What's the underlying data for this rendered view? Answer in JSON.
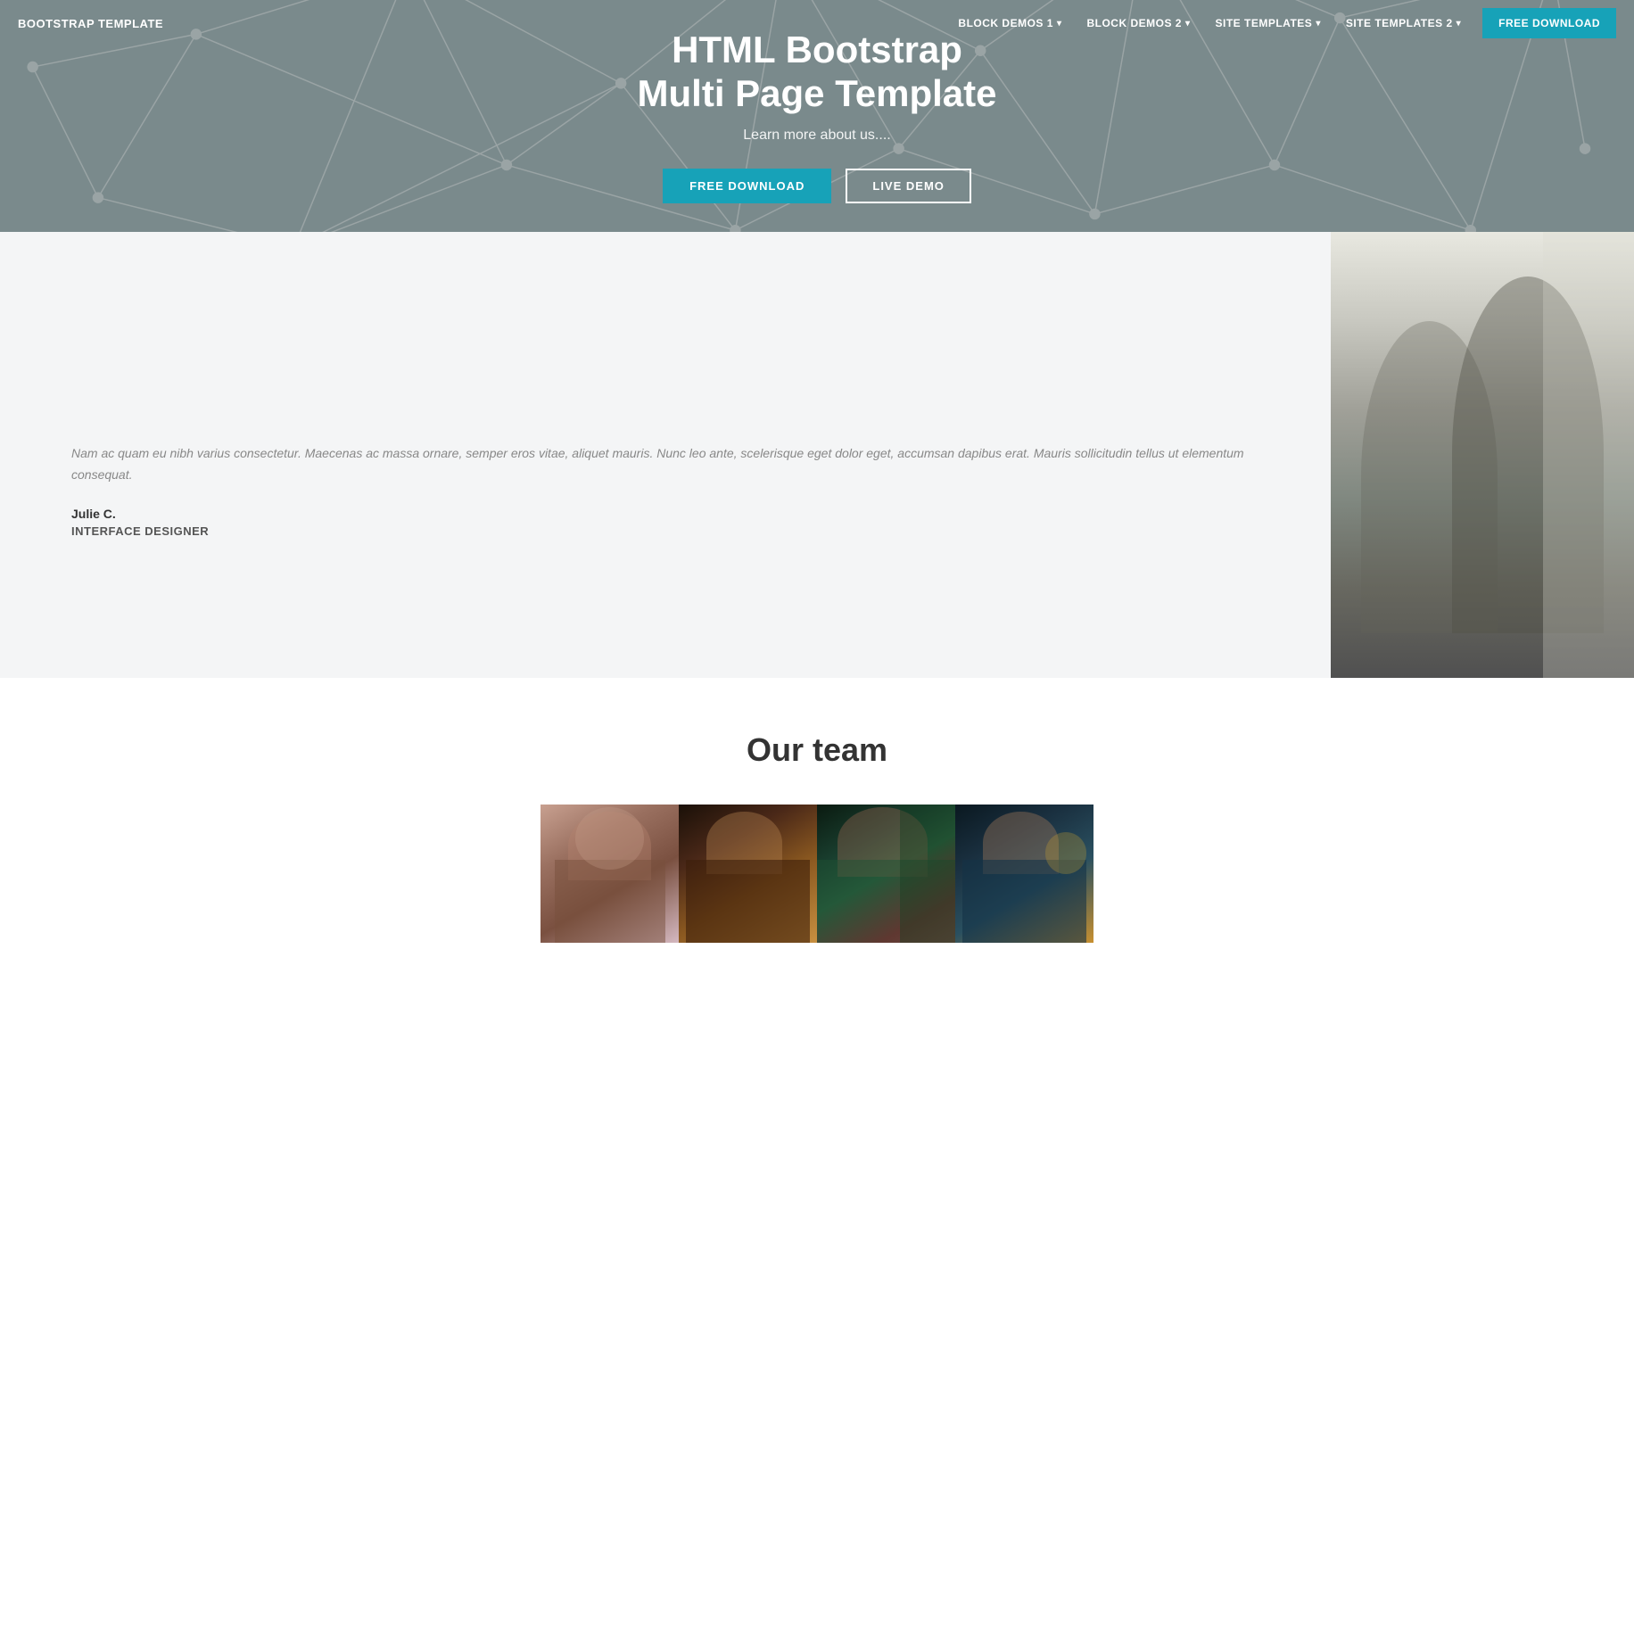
{
  "nav": {
    "brand": "BOOTSTRAP TEMPLATE",
    "links": [
      {
        "label": "BLOCK DEMOS 1",
        "has_caret": true
      },
      {
        "label": "BLOCK DEMOS 2",
        "has_caret": true
      },
      {
        "label": "SITE TEMPLATES",
        "has_caret": true
      },
      {
        "label": "SITE TEMPLATES 2",
        "has_caret": true
      }
    ],
    "cta_label": "FREE DOWNLOAD"
  },
  "hero": {
    "title_line1": "HTML Bootstrap",
    "title_line2": "Multi Page Template",
    "subtitle": "Learn more about us....",
    "btn_download": "FREE DOWNLOAD",
    "btn_demo": "LIVE DEMO"
  },
  "content": {
    "quote": "Nam ac quam eu nibh varius consectetur. Maecenas ac massa ornare, semper eros vitae, aliquet mauris. Nunc leo ante, scelerisque eget dolor eget, accumsan dapibus erat. Mauris sollicitudin tellus ut elementum consequat.",
    "name": "Julie C.",
    "role": "INTERFACE DESIGNER"
  },
  "team": {
    "title": "Our team",
    "members": [
      {
        "alt": "Team member 1 - woman with bun"
      },
      {
        "alt": "Team member 2 - woman with glasses"
      },
      {
        "alt": "Team member 3 - woman with curly hair"
      },
      {
        "alt": "Team member 4 - woman with jewelry"
      }
    ]
  }
}
